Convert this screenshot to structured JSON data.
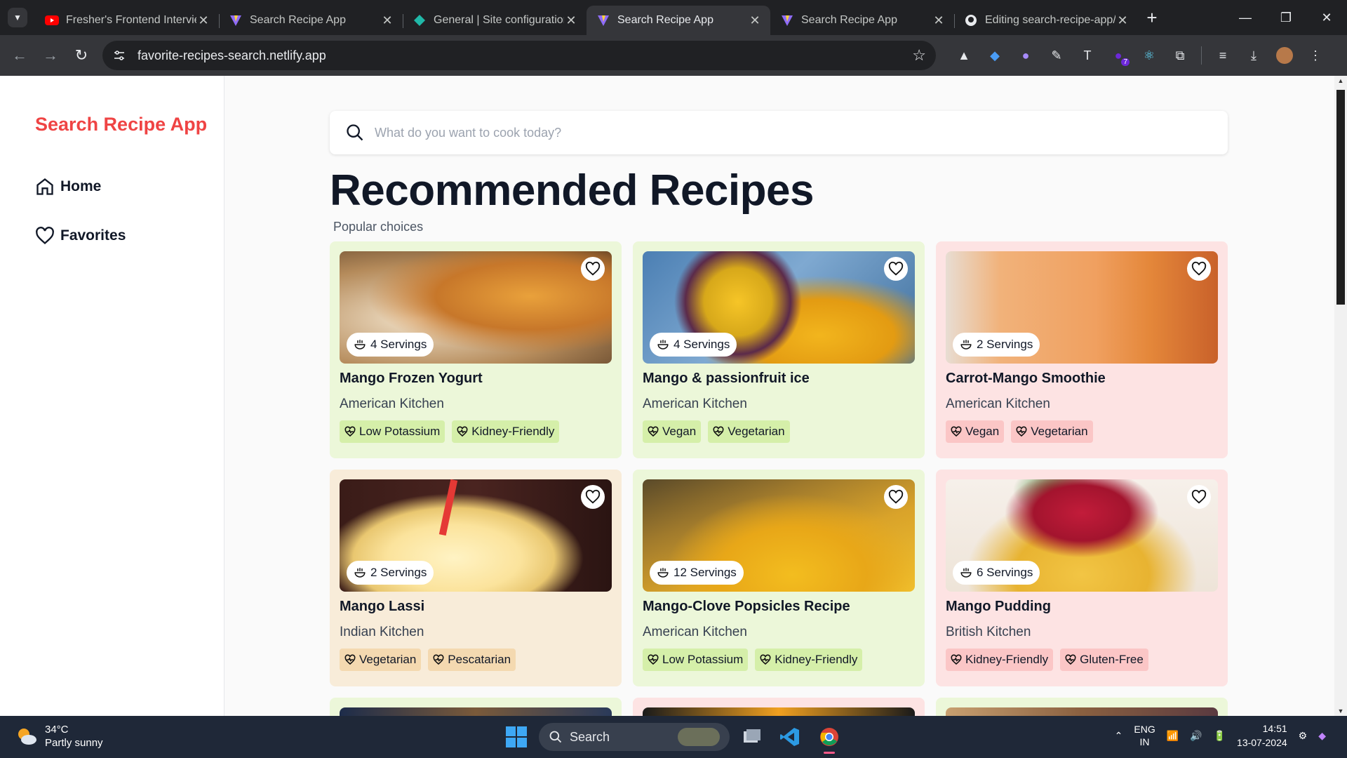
{
  "browser": {
    "tabs": [
      {
        "title": "Fresher's Frontend Intervie",
        "favicon": "youtube-icon",
        "active": false
      },
      {
        "title": "Search Recipe App",
        "favicon": "vite-icon",
        "active": false
      },
      {
        "title": "General | Site configuration",
        "favicon": "netlify-icon",
        "active": false
      },
      {
        "title": "Search Recipe App",
        "favicon": "vite-icon",
        "active": true
      },
      {
        "title": "Search Recipe App",
        "favicon": "vite-icon",
        "active": false
      },
      {
        "title": "Editing search-recipe-app/",
        "favicon": "github-icon",
        "active": false
      }
    ],
    "url": "favorite-recipes-search.netlify.app",
    "extension_badge": "7"
  },
  "app": {
    "brand": "Search Recipe App",
    "nav": [
      {
        "label": "Home",
        "icon": "home-icon"
      },
      {
        "label": "Favorites",
        "icon": "heart-icon"
      }
    ],
    "search_placeholder": "What do you want to cook today?",
    "heading": "Recommended Recipes",
    "subheading": "Popular choices",
    "recipes": [
      {
        "name": "Mango Frozen Yogurt",
        "kitchen": "American Kitchen",
        "servings": "4 Servings",
        "tags": [
          "Low Potassium",
          "Kidney-Friendly"
        ],
        "theme": "green"
      },
      {
        "name": "Mango & passionfruit ice",
        "kitchen": "American Kitchen",
        "servings": "4 Servings",
        "tags": [
          "Vegan",
          "Vegetarian"
        ],
        "theme": "green"
      },
      {
        "name": "Carrot-Mango Smoothie",
        "kitchen": "American Kitchen",
        "servings": "2 Servings",
        "tags": [
          "Vegan",
          "Vegetarian"
        ],
        "theme": "pink"
      },
      {
        "name": "Mango Lassi",
        "kitchen": "Indian Kitchen",
        "servings": "2 Servings",
        "tags": [
          "Vegetarian",
          "Pescatarian"
        ],
        "theme": "peach"
      },
      {
        "name": "Mango-Clove Popsicles Recipe",
        "kitchen": "American Kitchen",
        "servings": "12 Servings",
        "tags": [
          "Low Potassium",
          "Kidney-Friendly"
        ],
        "theme": "green"
      },
      {
        "name": "Mango Pudding",
        "kitchen": "British Kitchen",
        "servings": "6 Servings",
        "tags": [
          "Kidney-Friendly",
          "Gluten-Free"
        ],
        "theme": "pink"
      }
    ],
    "colors": {
      "brand": "#ef4444",
      "green_card": "#ecf7d9",
      "pink_card": "#fde3e3",
      "peach_card": "#f8ecd9"
    }
  },
  "taskbar": {
    "temperature": "34°C",
    "weather": "Partly sunny",
    "search_label": "Search",
    "lang_line1": "ENG",
    "lang_line2": "IN",
    "time": "14:51",
    "date": "13-07-2024"
  }
}
